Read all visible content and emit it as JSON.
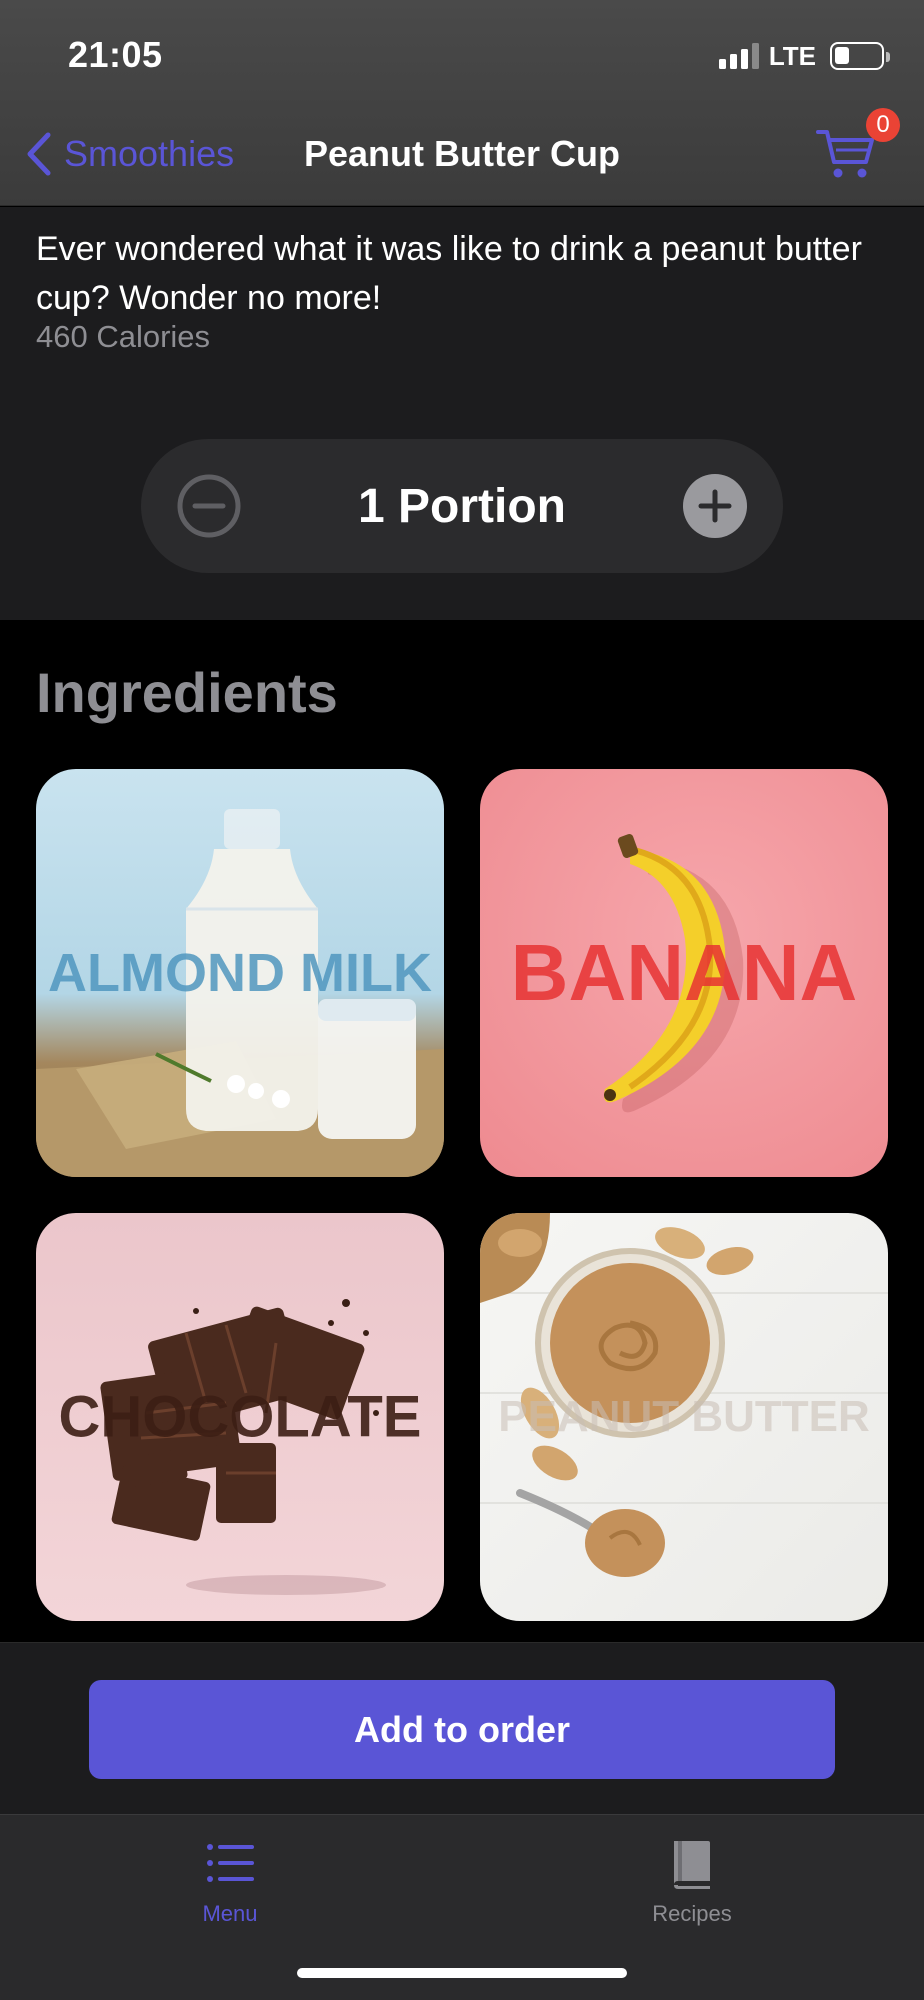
{
  "status_bar": {
    "time": "21:05",
    "network": "LTE"
  },
  "nav": {
    "back_label": "Smoothies",
    "title": "Peanut Butter Cup",
    "cart_count": "0",
    "accent_color": "#5a55d6",
    "badge_color": "#ea4335"
  },
  "product": {
    "description": "Ever wondered what it was like to drink a peanut butter cup? Wonder no more!",
    "calories": "460 Calories"
  },
  "portion": {
    "label": "1 Portion",
    "minus_icon": "minus-circle-icon",
    "plus_icon": "plus-circle-icon"
  },
  "ingredients": {
    "title": "Ingredients",
    "items": [
      {
        "label": "ALMOND MILK"
      },
      {
        "label": "BANANA"
      },
      {
        "label": "CHOCOLATE"
      },
      {
        "label": "PEANUT BUTTER"
      }
    ]
  },
  "order": {
    "button_label": "Add to order"
  },
  "tabbar": {
    "items": [
      {
        "label": "Menu",
        "icon": "list-icon",
        "active": true
      },
      {
        "label": "Recipes",
        "icon": "book-icon",
        "active": false
      }
    ]
  }
}
